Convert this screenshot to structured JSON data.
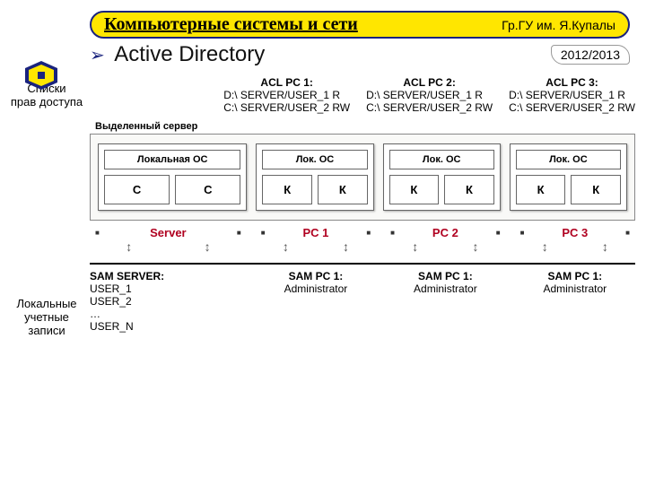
{
  "header": {
    "title": "Компьютерные системы и сети",
    "org": "Гр.ГУ им. Я.Купалы",
    "arrow_glyph": "➢",
    "section": "Active Directory",
    "year": "2012/2013"
  },
  "sidebar": {
    "top_label_l1": "Списки",
    "top_label_l2": "прав доступа",
    "bottom_label_l1": "Локальные",
    "bottom_label_l2": "учетные",
    "bottom_label_l3": "записи"
  },
  "acl": [
    {
      "title": "ACL PC 1:",
      "lines": [
        "D:\\ SERVER/USER_1  R",
        "C:\\ SERVER/USER_2  RW"
      ]
    },
    {
      "title": "ACL PC 2:",
      "lines": [
        "D:\\ SERVER/USER_1  R",
        "C:\\ SERVER/USER_2  RW"
      ]
    },
    {
      "title": "ACL PC 3:",
      "lines": [
        "D:\\ SERVER/USER_1  R",
        "C:\\ SERVER/USER_2  RW"
      ]
    }
  ],
  "diagram": {
    "server": {
      "top": "Выделенный сервер",
      "os": "Локальная ОС",
      "disks": [
        "C",
        "C"
      ]
    },
    "pcs": [
      {
        "os": "Лок. ОС",
        "disks": [
          "К",
          "К"
        ]
      },
      {
        "os": "Лок. ОС",
        "disks": [
          "К",
          "К"
        ]
      },
      {
        "os": "Лок. ОС",
        "disks": [
          "К",
          "К"
        ]
      }
    ]
  },
  "labels": {
    "server": "Server",
    "pcs": [
      "PC 1",
      "PC 2",
      "PC 3"
    ]
  },
  "sam": {
    "server": {
      "title": "SAM SERVER:",
      "lines": [
        "USER_1",
        "USER_2",
        "…",
        "USER_N"
      ]
    },
    "pcs": [
      {
        "title": "SAM PC 1:",
        "line": "Administrator"
      },
      {
        "title": "SAM PC 1:",
        "line": "Administrator"
      },
      {
        "title": "SAM PC 1:",
        "line": "Administrator"
      }
    ]
  }
}
